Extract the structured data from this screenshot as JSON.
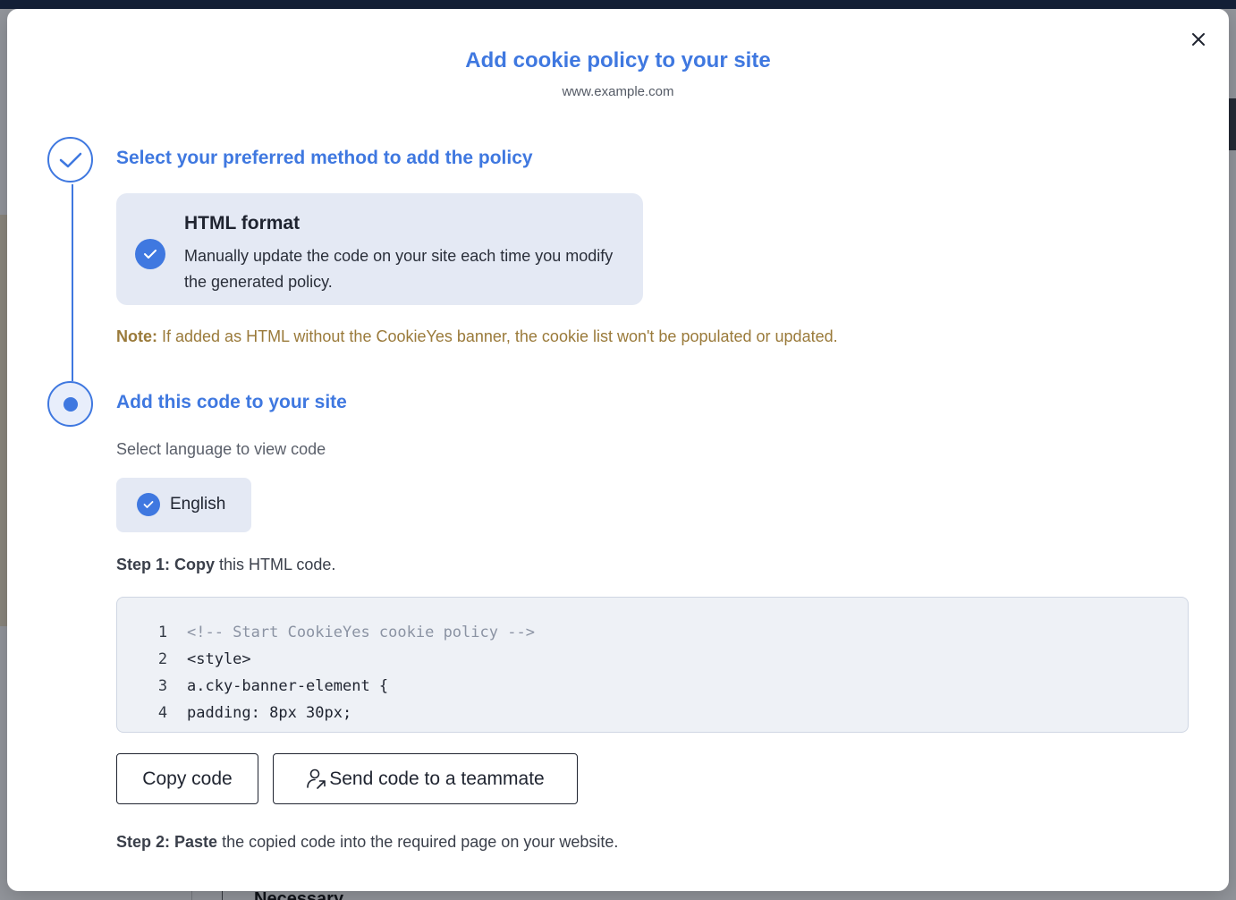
{
  "modal": {
    "title": "Add cookie policy to your site",
    "subtitle": "www.example.com",
    "close_label": "×"
  },
  "step1": {
    "heading": "Select your preferred method to add the policy",
    "card_title": "HTML format",
    "card_desc": "Manually update the code on your site each time you modify the generated policy."
  },
  "note": {
    "label": "Note:",
    "text": " If added as HTML without the CookieYes banner, the cookie list won't be populated or updated."
  },
  "step2": {
    "heading": "Add this code to your site",
    "select_language": "Select language to view code",
    "language": "English"
  },
  "instructions": {
    "step1_prefix": "Step 1:",
    "step1_action": "Copy",
    "step1_rest": " this HTML code.",
    "step2_prefix": "Step 2:",
    "step2_action": "Paste",
    "step2_rest": " the copied code into the required page on your website."
  },
  "code": {
    "lines": [
      {
        "num": "1",
        "text": "<!-- Start CookieYes cookie policy -->"
      },
      {
        "num": "2",
        "text": "<style>"
      },
      {
        "num": "3",
        "text": "a.cky-banner-element {"
      },
      {
        "num": "4",
        "text": "padding: 8px 30px;"
      }
    ]
  },
  "buttons": {
    "copy": "Copy code",
    "send": "Send code to a teammate"
  },
  "background": {
    "bottom_text": "Necessary"
  },
  "colors": {
    "accent": "#3f78e0",
    "note": "#9a7a3a",
    "card_bg": "#e4e9f4"
  }
}
